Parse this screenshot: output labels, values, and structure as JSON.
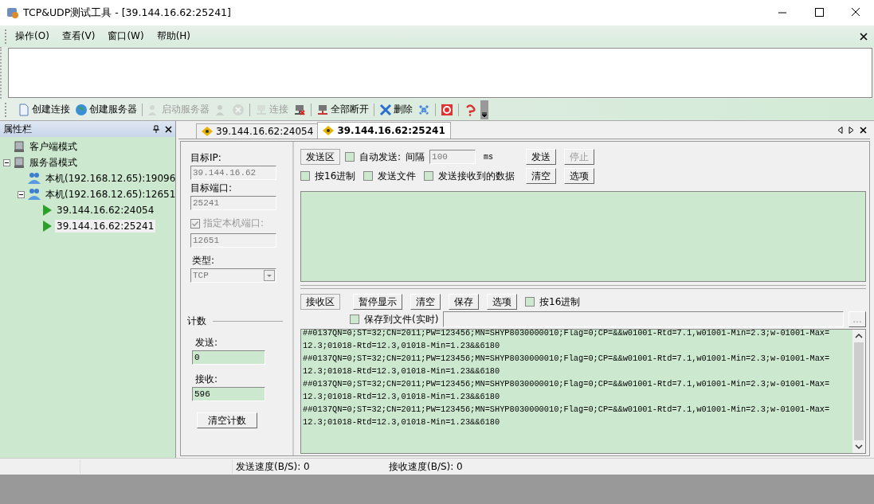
{
  "window": {
    "title": "TCP&UDP测试工具 - [39.144.16.62:25241]"
  },
  "menu": [
    "操作(O)",
    "查看(V)",
    "窗口(W)",
    "帮助(H)"
  ],
  "toolbar": [
    {
      "kind": "labeled",
      "label": "创建连接",
      "disabled": false
    },
    {
      "kind": "labeled",
      "label": "创建服务器",
      "disabled": false
    },
    {
      "kind": "separator"
    },
    {
      "kind": "labeled",
      "label": "启动服务器",
      "disabled": true
    },
    {
      "kind": "icon",
      "disabled": true
    },
    {
      "kind": "icon",
      "disabled": true
    },
    {
      "kind": "separator"
    },
    {
      "kind": "labeled",
      "label": "连接",
      "disabled": true
    },
    {
      "kind": "icon",
      "disabled": false
    },
    {
      "kind": "separator"
    },
    {
      "kind": "labeled",
      "label": "全部断开",
      "disabled": false
    },
    {
      "kind": "separator"
    },
    {
      "kind": "labeled",
      "label": "删除",
      "disabled": false
    },
    {
      "kind": "icon",
      "disabled": false
    },
    {
      "kind": "separator"
    },
    {
      "kind": "icon",
      "disabled": false
    },
    {
      "kind": "separator"
    },
    {
      "kind": "icon",
      "disabled": false
    }
  ],
  "sidebar": {
    "title": "属性栏",
    "tree": [
      {
        "label": "客户端模式",
        "selected": false
      },
      {
        "label": "服务器模式",
        "selected": false,
        "expanded": true,
        "children": [
          {
            "label": "本机(192.168.12.65):19096",
            "selected": false
          },
          {
            "label": "本机(192.168.12.65):12651",
            "selected": false,
            "expanded": true,
            "children": [
              {
                "label": "39.144.16.62:24054",
                "selected": false
              },
              {
                "label": "39.144.16.62:25241",
                "selected": true
              }
            ]
          }
        ]
      }
    ]
  },
  "tabs": [
    {
      "label": "39.144.16.62:24054",
      "selected": false
    },
    {
      "label": "39.144.16.62:25241",
      "selected": true
    }
  ],
  "connection": {
    "target_ip_label": "目标IP:",
    "target_ip": "39.144.16.62",
    "target_port_label": "目标端口:",
    "target_port": "25241",
    "local_port_check": {
      "label": "指定本机端口:",
      "checked": true,
      "disabled": true
    },
    "local_port": "12651",
    "type_label": "类型:",
    "type": "TCP"
  },
  "counter": {
    "title": "计数",
    "sent_label": "发送:",
    "sent": "0",
    "received_label": "接收:",
    "received": "596",
    "clear_button": "清空计数"
  },
  "send": {
    "area_button": "发送区",
    "auto_send": {
      "label": "自动发送:",
      "checked": false
    },
    "interval_label": "间隔",
    "interval": "100",
    "unit": "ms",
    "send_button": "发送",
    "stop_button": {
      "label": "停止",
      "disabled": true
    },
    "options": [
      {
        "label": "按16进制",
        "checked": false
      },
      {
        "label": "发送文件",
        "checked": false
      },
      {
        "label": "发送接收到的数据",
        "checked": false
      }
    ],
    "clear_button": "清空",
    "options_button": "选项"
  },
  "receive": {
    "buttons": [
      "接收区",
      "暂停显示",
      "清空",
      "保存",
      "选项"
    ],
    "hex": {
      "label": "按16进制",
      "checked": false
    },
    "save_to_file": {
      "label": "保存到文件(实时)",
      "checked": false
    },
    "browse_button": "...",
    "log": [
      "##0137QN=0;ST=32;CN=2011;PW=123456;MN=SHYP8030000010;Flag=0;CP=&&w01001-Rtd=7.1,w01001-Min=2.3;w-01001-Max=",
      "12.3;01018-Rtd=12.3,01018-Min=1.23&&6180",
      "##0137QN=0;ST=32;CN=2011;PW=123456;MN=SHYP8030000010;Flag=0;CP=&&w01001-Rtd=7.1,w01001-Min=2.3;w-01001-Max=",
      "12.3;01018-Rtd=12.3,01018-Min=1.23&&6180",
      "##0137QN=0;ST=32;CN=2011;PW=123456;MN=SHYP8030000010;Flag=0;CP=&&w01001-Rtd=7.1,w01001-Min=2.3;w-01001-Max=",
      "12.3;01018-Rtd=12.3,01018-Min=1.23&&6180",
      "##0137QN=0;ST=32;CN=2011;PW=123456;MN=SHYP8030000010;Flag=0;CP=&&w01001-Rtd=7.1,w01001-Min=2.3;w-01001-Max=",
      "12.3;01018-Rtd=12.3,01018-Min=1.23&&6180"
    ]
  },
  "status_bar": {
    "send_speed": "发送速度(B/S): 0",
    "receive_speed": "接收速度(B/S): 0"
  }
}
